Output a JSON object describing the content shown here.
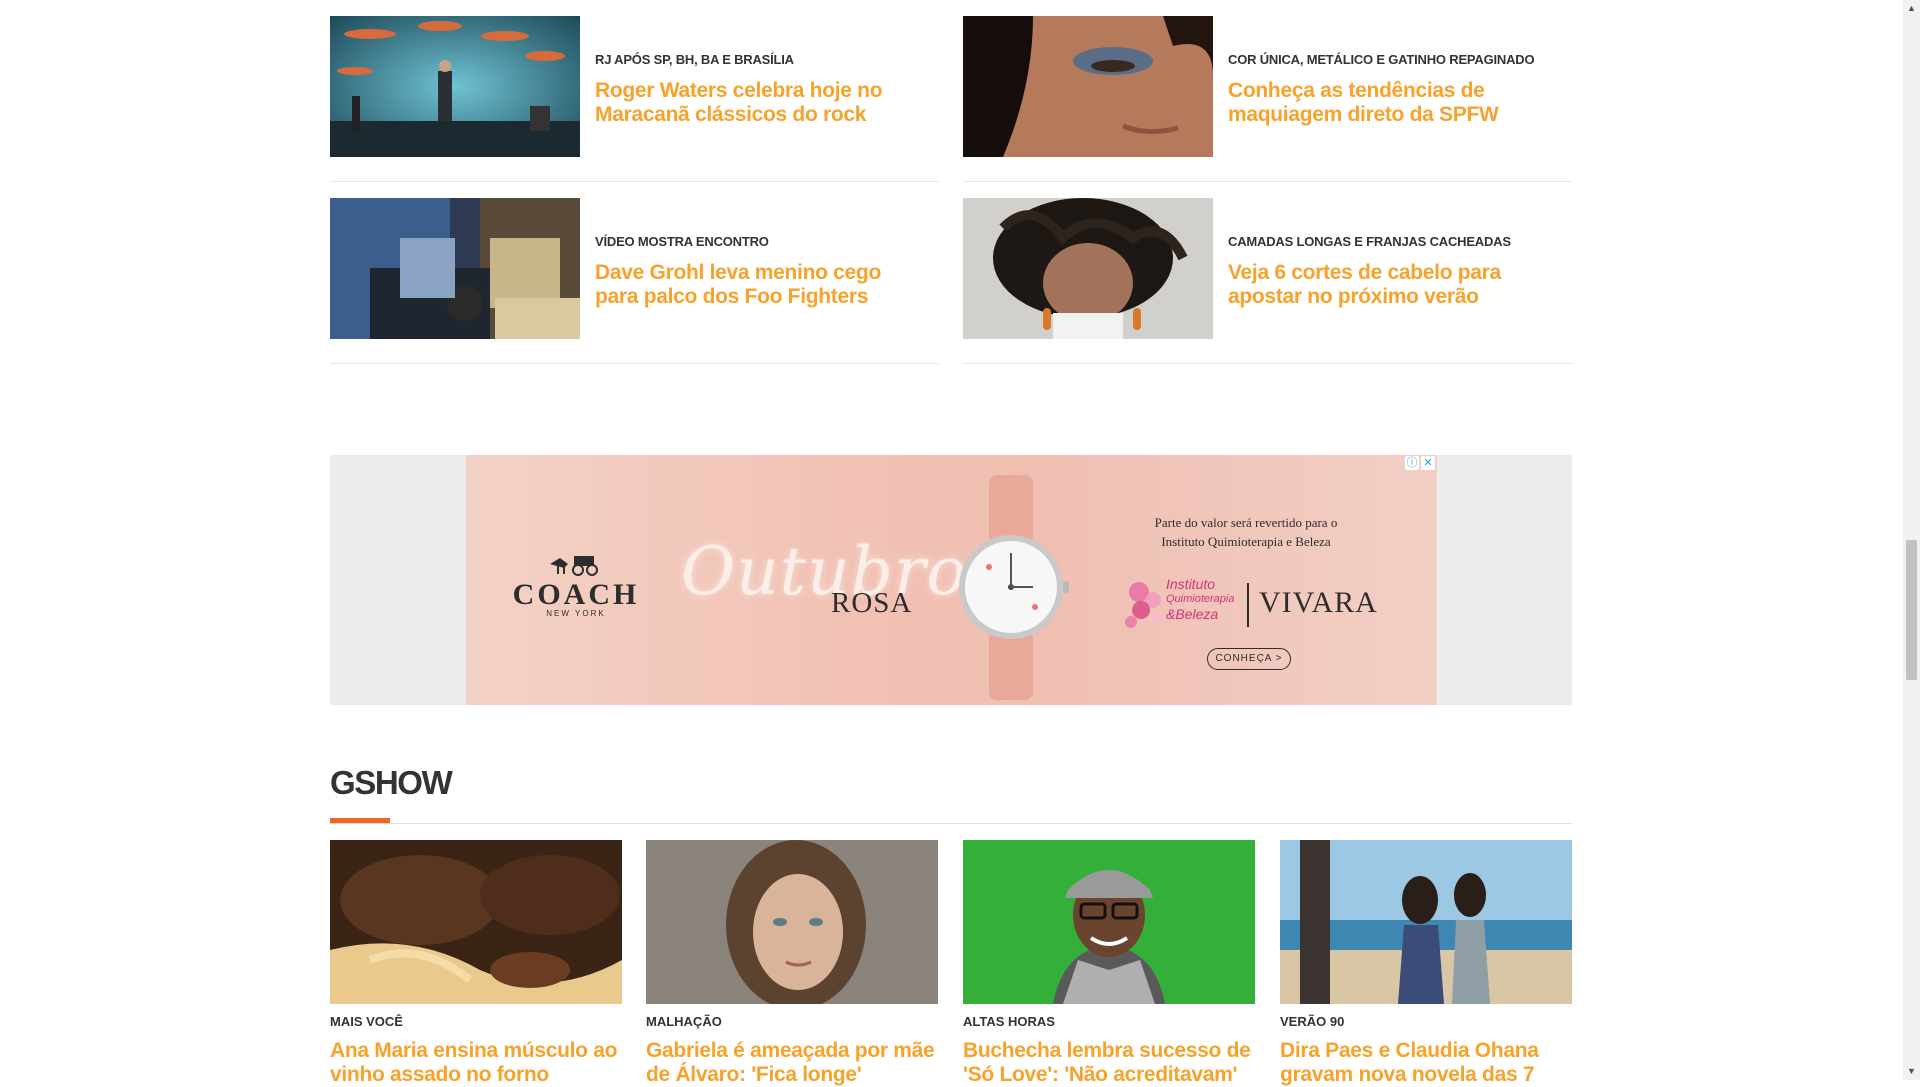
{
  "news": [
    {
      "kicker": "RJ APÓS SP, BH, BA E BRASÍLIA",
      "headline": "Roger Waters celebra hoje no Maracanã clássicos do rock",
      "thumb_icon": "concert-photo"
    },
    {
      "kicker": "COR ÚNICA, METÁLICO E GATINHO REPAGINADO",
      "headline": "Conheça as tendências de maquiagem direto da SPFW",
      "thumb_icon": "makeup-photo"
    },
    {
      "kicker": "VÍDEO MOSTRA ENCONTRO",
      "headline": "Dave Grohl leva menino cego para palco dos Foo Fighters",
      "thumb_icon": "stage-photo"
    },
    {
      "kicker": "CAMADAS LONGAS E FRANJAS CACHEADAS",
      "headline": "Veja 6 cortes de cabelo para apostar no próximo verão",
      "thumb_icon": "haircut-photo"
    }
  ],
  "ad": {
    "brand": "COACH",
    "brand_sub": "NEW YORK",
    "campaign_script": "Outubro",
    "campaign_word": "ROSA",
    "copy_line1": "Parte do valor será revertido para o",
    "copy_line2": "Instituto Quimioterapia e Beleza",
    "partner_line1": "Instituto",
    "partner_line2": "Quimioterapia",
    "partner_line3": "&Beleza",
    "retailer": "VIVARA",
    "cta": "CONHEÇA >",
    "info_icon": "ⓘ",
    "close_icon": "✕"
  },
  "gshow": {
    "title": "GSHOW",
    "accent": "#f26522",
    "cards": [
      {
        "kicker": "MAIS VOCÊ",
        "title": "Ana Maria ensina músculo ao vinho assado no forno",
        "thumb_icon": "food-photo"
      },
      {
        "kicker": "MALHAÇÃO",
        "title": "Gabriela é ameaçada por mãe de Álvaro: 'Fica longe'",
        "thumb_icon": "actress-photo"
      },
      {
        "kicker": "ALTAS HORAS",
        "title": "Buchecha lembra sucesso de 'Só Love': 'Não acreditavam'",
        "thumb_icon": "singer-photo"
      },
      {
        "kicker": "VERÃO 90",
        "title": "Dira Paes e Claudia Ohana gravam nova novela das 7",
        "thumb_icon": "beach-photo"
      }
    ]
  },
  "colors": {
    "headline": "#f6a22b",
    "kicker": "#333333"
  },
  "scrollbar": {
    "up": "▲",
    "down": "▼"
  }
}
